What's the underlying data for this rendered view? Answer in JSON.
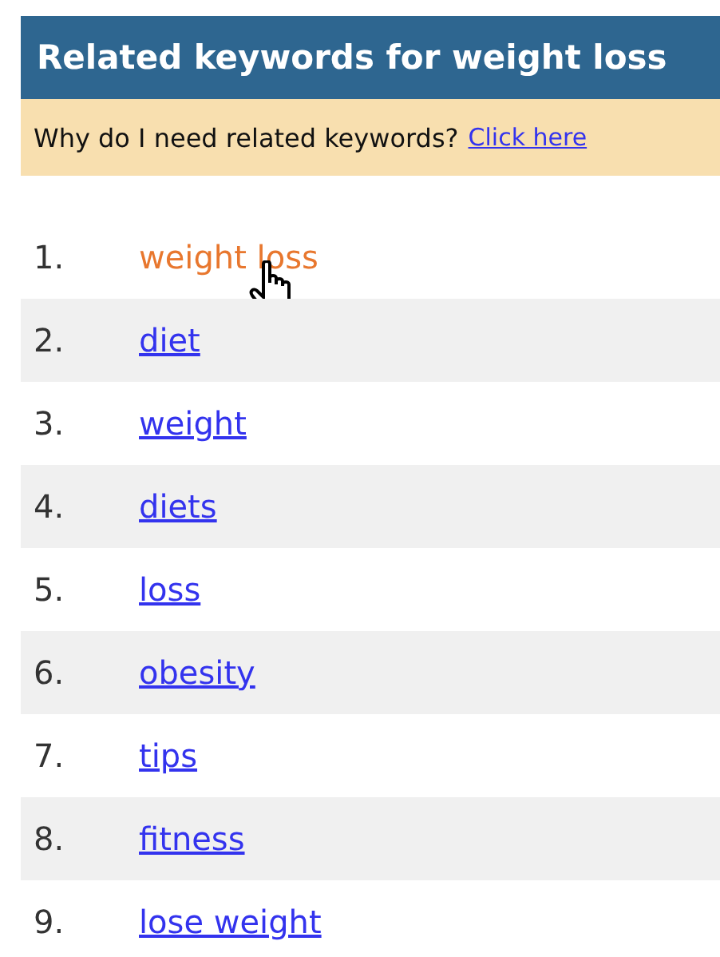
{
  "header": {
    "title": "Related keywords for weight loss"
  },
  "info": {
    "question": "Why do I need related keywords?",
    "link": "Click here"
  },
  "keywords": [
    {
      "number": "1.",
      "label": "weight loss",
      "hovered": true
    },
    {
      "number": "2.",
      "label": "diet",
      "hovered": false
    },
    {
      "number": "3.",
      "label": "weight",
      "hovered": false
    },
    {
      "number": "4.",
      "label": "diets",
      "hovered": false
    },
    {
      "number": "5.",
      "label": "loss",
      "hovered": false
    },
    {
      "number": "6.",
      "label": "obesity",
      "hovered": false
    },
    {
      "number": "7.",
      "label": "tips",
      "hovered": false
    },
    {
      "number": "8.",
      "label": "fitness",
      "hovered": false
    },
    {
      "number": "9.",
      "label": "lose weight",
      "hovered": false
    }
  ]
}
